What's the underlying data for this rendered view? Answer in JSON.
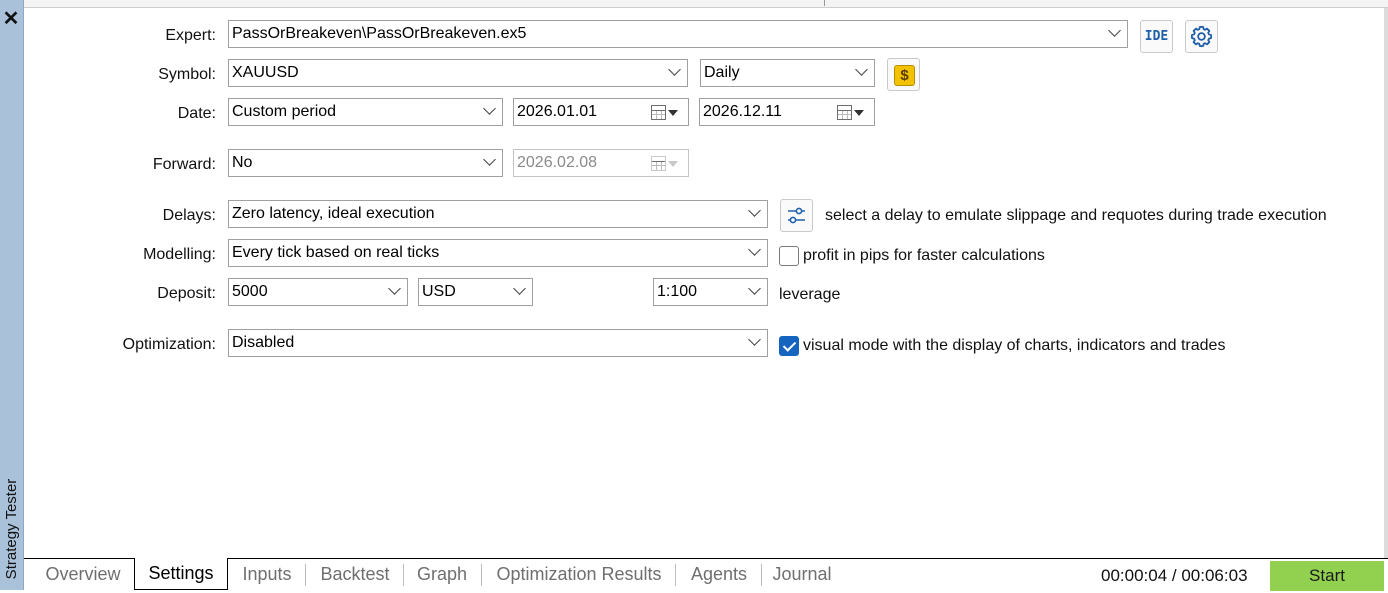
{
  "panel": {
    "title": "Strategy Tester",
    "close_glyph": "✕"
  },
  "form": {
    "expert": {
      "label": "Expert:",
      "value": "PassOrBreakeven\\PassOrBreakeven.ex5",
      "ide_button": "IDE"
    },
    "symbol": {
      "label": "Symbol:",
      "value": "XAUUSD",
      "timeframe": "Daily",
      "coin_glyph": "$"
    },
    "date": {
      "label": "Date:",
      "period": "Custom period",
      "from": "2026.01.01",
      "to": "2026.12.11"
    },
    "forward": {
      "label": "Forward:",
      "value": "No",
      "date": "2026.02.08"
    },
    "delays": {
      "label": "Delays:",
      "value": "Zero latency, ideal execution",
      "hint": "select a delay to emulate slippage and requotes during trade execution"
    },
    "modelling": {
      "label": "Modelling:",
      "value": "Every tick based on real ticks",
      "pips_checkbox_label": "profit in pips for faster calculations",
      "pips_checked": false
    },
    "deposit": {
      "label": "Deposit:",
      "value": "5000",
      "currency": "USD",
      "leverage_value": "1:100",
      "leverage_label": "leverage"
    },
    "optimization": {
      "label": "Optimization:",
      "value": "Disabled",
      "visual_checkbox_label": "visual mode with the display of charts, indicators and trades",
      "visual_checked": true
    }
  },
  "tabs": [
    {
      "label": "Overview",
      "active": false
    },
    {
      "label": "Settings",
      "active": true
    },
    {
      "label": "Inputs",
      "active": false
    },
    {
      "label": "Backtest",
      "active": false
    },
    {
      "label": "Graph",
      "active": false
    },
    {
      "label": "Optimization Results",
      "active": false
    },
    {
      "label": "Agents",
      "active": false
    },
    {
      "label": "Journal",
      "active": false
    }
  ],
  "status": {
    "timer": "00:00:04 / 00:06:03",
    "start_label": "Start"
  },
  "colors": {
    "side_panel": "#a9c1d9",
    "start_button": "#92d050",
    "checkbox_checked": "#1565c0",
    "accent_icon": "#1f5fa8"
  }
}
